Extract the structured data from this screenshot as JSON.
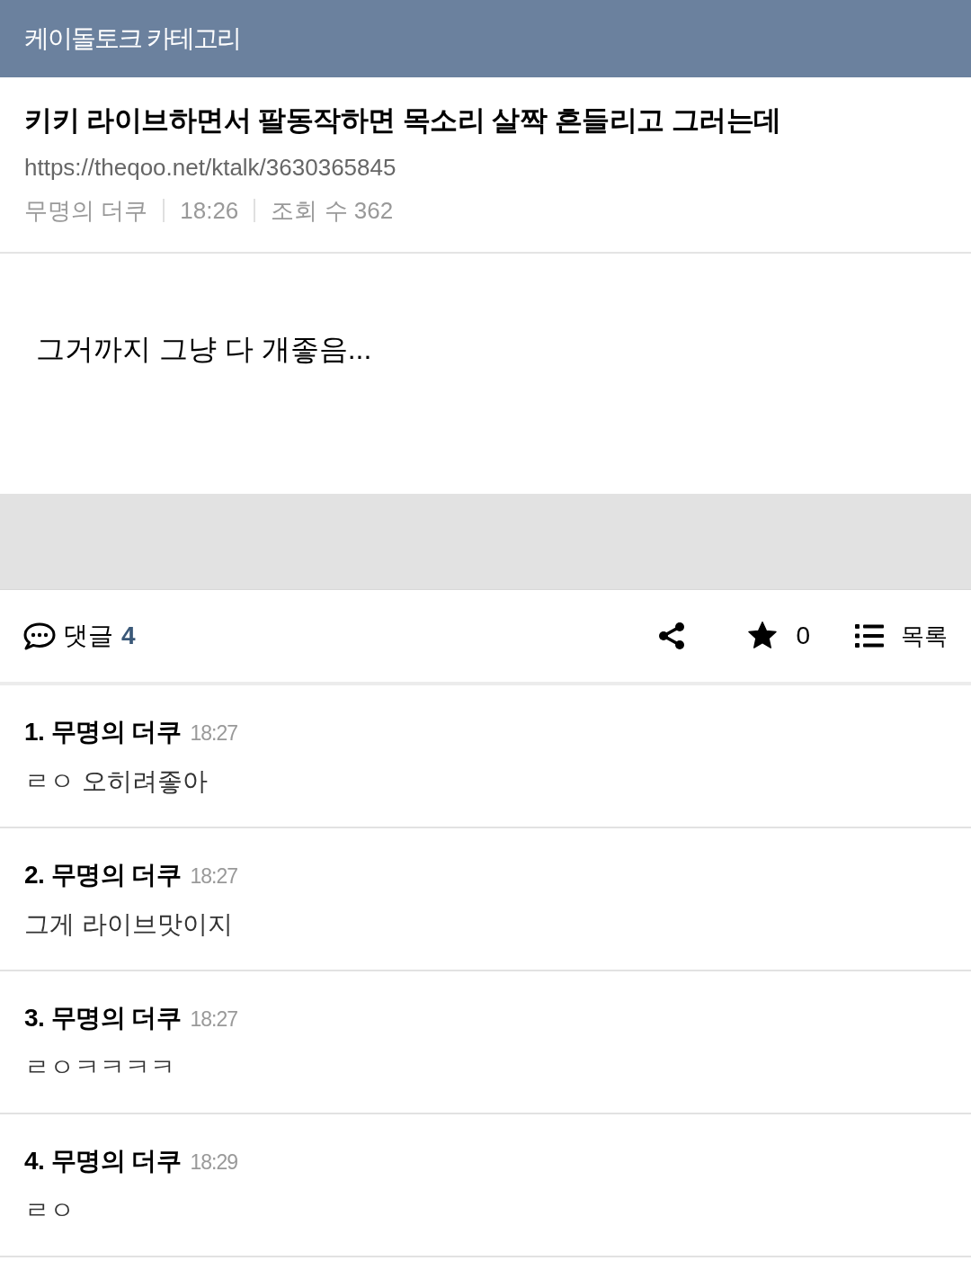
{
  "header": {
    "title": "케이돌토크 카테고리"
  },
  "post": {
    "title": "키키 라이브하면서 팔동작하면 목소리 살짝 흔들리고 그러는데",
    "url": "https://theqoo.net/ktalk/3630365845",
    "meta": [
      "무명의 더쿠",
      "18:26",
      "조회 수 362"
    ],
    "body": "그거까지 그냥 다 개좋음..."
  },
  "actions": {
    "comments_label": "댓글",
    "comment_count": "4",
    "star_count": "0",
    "list_label": "목록"
  },
  "comments": [
    {
      "heading": "1. 무명의 더쿠",
      "time": "18:27",
      "text": "ㄹㅇ 오히려좋아"
    },
    {
      "heading": "2. 무명의 더쿠",
      "time": "18:27",
      "text": "그게 라이브맛이지"
    },
    {
      "heading": "3. 무명의 더쿠",
      "time": "18:27",
      "text": "ㄹㅇㅋㅋㅋㅋ"
    },
    {
      "heading": "4. 무명의 더쿠",
      "time": "18:29",
      "text": "ㄹㅇ"
    }
  ]
}
